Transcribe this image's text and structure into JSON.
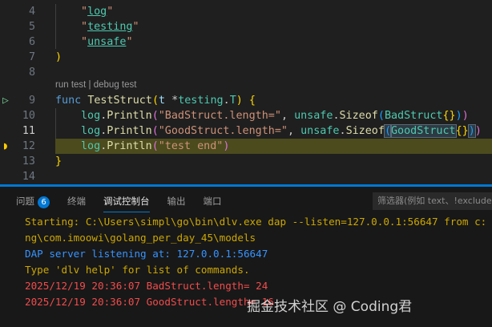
{
  "editor": {
    "lines": [
      {
        "n": "4",
        "text": "\"log\""
      },
      {
        "n": "5",
        "text": "\"testing\""
      },
      {
        "n": "6",
        "text": "\"unsafe\""
      },
      {
        "n": "7",
        "text": ")"
      },
      {
        "n": "8",
        "text": ""
      },
      {
        "n": "9",
        "text": "func TestStruct(t *testing.T) {"
      },
      {
        "n": "10",
        "text": "log.Println(\"BadStruct.length=\", unsafe.Sizeof(BadStruct{}))"
      },
      {
        "n": "11",
        "text": "log.Println(\"GoodStruct.length=\", unsafe.Sizeof(GoodStruct{}))"
      },
      {
        "n": "12",
        "text": "log.Println(\"test end\")"
      },
      {
        "n": "13",
        "text": "}"
      },
      {
        "n": "14",
        "text": ""
      }
    ],
    "codelens": "run test | debug test"
  },
  "panel": {
    "tabs": [
      {
        "label": "问题",
        "badge": "6"
      },
      {
        "label": "终端"
      },
      {
        "label": "调试控制台"
      },
      {
        "label": "输出"
      },
      {
        "label": "端口"
      }
    ],
    "active_tab": "调试控制台",
    "filter_placeholder": "筛选器(例如 text、!exclude",
    "output": [
      "Starting: C:\\Users\\simpl\\go\\bin\\dlv.exe dap --listen=127.0.0.1:56647 from c:",
      "ng\\com.imoowi\\golang_per_day_45\\models",
      "DAP server listening at: 127.0.0.1:56647",
      "Type 'dlv help' for list of commands.",
      "2025/12/19 20:36:07 BadStruct.length= 24",
      "2025/12/19 20:36:07 GoodStruct.length= 16"
    ]
  },
  "watermark": "掘金技术社区 @ Coding君"
}
